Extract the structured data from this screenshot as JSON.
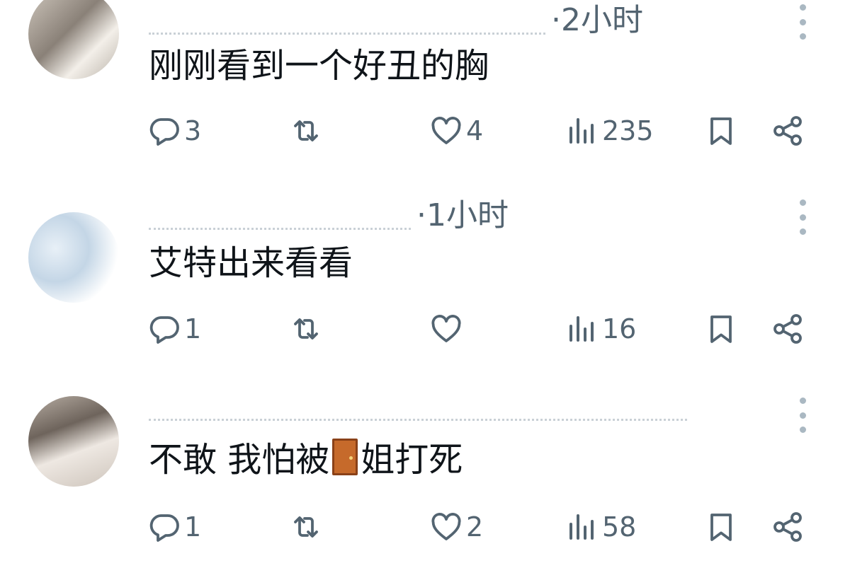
{
  "posts": [
    {
      "header_text": "·2小时",
      "body": "刚刚看到一个好丑的胸",
      "reply_count": "3",
      "like_count": "4",
      "view_count": "235"
    },
    {
      "header_text": "·1小时",
      "body": "艾特出来看看",
      "reply_count": "1",
      "like_count": "",
      "view_count": "16"
    },
    {
      "header_text": "",
      "body_before_emoji": "不敢 我怕被",
      "body_after_emoji": "姐打死",
      "emoji": "door-emoji",
      "reply_count": "1",
      "like_count": "2",
      "view_count": "58"
    }
  ],
  "icons": {
    "reply": "reply-icon",
    "repost": "repost-icon",
    "like": "heart-icon",
    "views": "views-icon",
    "bookmark": "bookmark-icon",
    "share": "share-icon",
    "more": "more-vertical-icon"
  },
  "colors": {
    "icon_gray": "#536471",
    "text": "#0f1419",
    "dot_gray": "#aab8c2"
  }
}
